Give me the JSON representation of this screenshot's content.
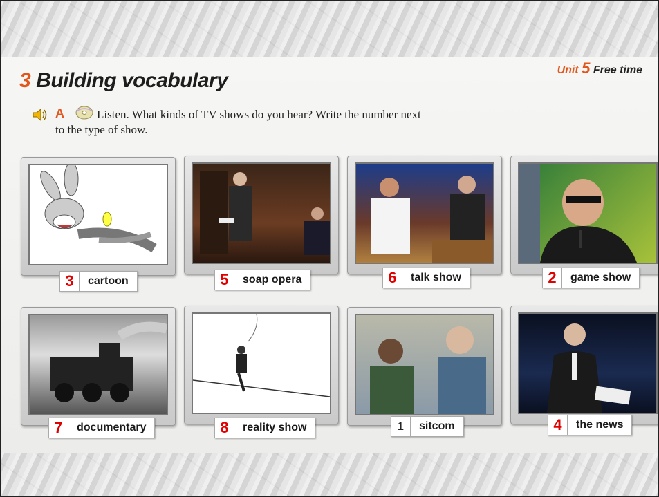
{
  "header": {
    "unit_label": "Unit",
    "unit_number": "5",
    "unit_title": "Free time",
    "section_number": "3",
    "section_title": "Building vocabulary"
  },
  "exercise": {
    "letter": "A",
    "instruction_line1": "Listen. What kinds of TV shows do you hear? Write the number next",
    "instruction_line2": "to the type of show."
  },
  "shows": [
    {
      "number": "3",
      "label": "cartoon"
    },
    {
      "number": "5",
      "label": "soap opera"
    },
    {
      "number": "6",
      "label": "talk show"
    },
    {
      "number": "2",
      "label": "game show"
    },
    {
      "number": "7",
      "label": "documentary"
    },
    {
      "number": "8",
      "label": "reality show"
    },
    {
      "number": "1",
      "label": "sitcom"
    },
    {
      "number": "4",
      "label": "the news"
    }
  ],
  "icons": [
    "speaker-icon",
    "cd-icon"
  ],
  "colors": {
    "accent": "#e2561c",
    "answer": "#e00000"
  }
}
